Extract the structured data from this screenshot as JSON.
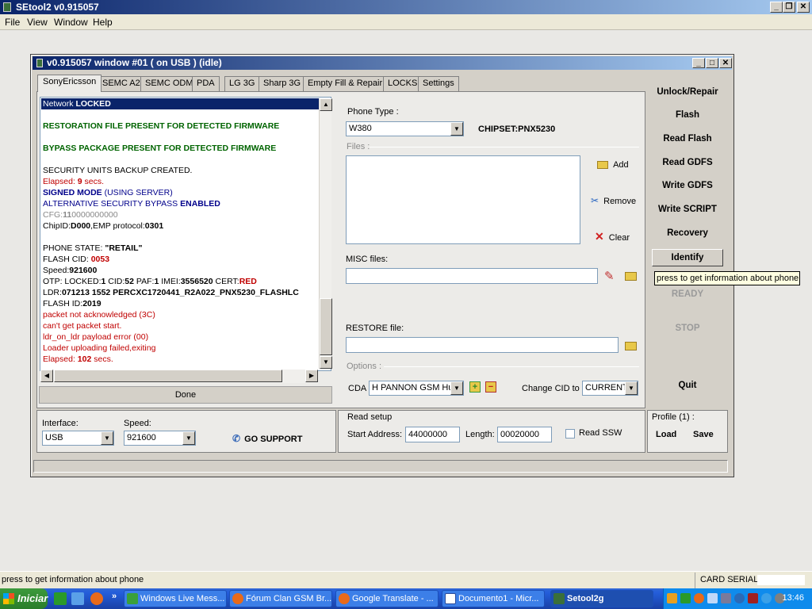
{
  "app": {
    "title": "SEtool2 v0.915057"
  },
  "menu": [
    "File",
    "View",
    "Window",
    "Help"
  ],
  "child": {
    "title": "v0.915057 window #01 ( on USB ) (idle)"
  },
  "tabs": [
    "SonyEricsson",
    "SEMC A2",
    "SEMC ODM",
    "PDA",
    "LG 3G",
    "Sharp 3G",
    "Empty Fill & Repair",
    "LOCKS",
    "Settings"
  ],
  "log": [
    {
      "parts": [
        {
          "t": "Network ",
          "c": ""
        },
        {
          "t": "LOCKED",
          "c": "b"
        }
      ],
      "selected": true
    },
    {
      "parts": []
    },
    {
      "parts": [
        {
          "t": "RESTORATION FILE PRESENT FOR DETECTED FIRMWARE",
          "c": "green b"
        }
      ]
    },
    {
      "parts": []
    },
    {
      "parts": [
        {
          "t": "BYPASS PACKAGE PRESENT FOR DETECTED FIRMWARE",
          "c": "green b"
        }
      ]
    },
    {
      "parts": []
    },
    {
      "parts": [
        {
          "t": "SECURITY UNITS BACKUP CREATED.",
          "c": ""
        }
      ]
    },
    {
      "parts": [
        {
          "t": "Elapsed: ",
          "c": "red"
        },
        {
          "t": "9",
          "c": "red b"
        },
        {
          "t": " secs.",
          "c": "red"
        }
      ]
    },
    {
      "parts": [
        {
          "t": "SIGNED MODE",
          "c": "blue b"
        },
        {
          "t": " (USING SERVER)",
          "c": "blue"
        }
      ]
    },
    {
      "parts": [
        {
          "t": "ALTERNATIVE SECURITY BYPASS ",
          "c": "blue"
        },
        {
          "t": "ENABLED",
          "c": "blue b"
        }
      ]
    },
    {
      "parts": [
        {
          "t": "CFG:",
          "c": "gray"
        },
        {
          "t": "11",
          "c": "gray b"
        },
        {
          "t": "0000000000",
          "c": "gray"
        }
      ]
    },
    {
      "parts": [
        {
          "t": "ChipID:",
          "c": ""
        },
        {
          "t": "D000",
          "c": "b"
        },
        {
          "t": ",EMP protocol:",
          "c": ""
        },
        {
          "t": "0301",
          "c": "b"
        }
      ]
    },
    {
      "parts": []
    },
    {
      "parts": [
        {
          "t": "PHONE STATE: ",
          "c": ""
        },
        {
          "t": "\"RETAIL\"",
          "c": "b"
        }
      ]
    },
    {
      "parts": [
        {
          "t": "FLASH CID: ",
          "c": ""
        },
        {
          "t": "0053",
          "c": "red b"
        }
      ]
    },
    {
      "parts": [
        {
          "t": "Speed:",
          "c": ""
        },
        {
          "t": "921600",
          "c": "b"
        }
      ]
    },
    {
      "parts": [
        {
          "t": "OTP: LOCKED:",
          "c": ""
        },
        {
          "t": "1",
          "c": "b"
        },
        {
          "t": " CID:",
          "c": ""
        },
        {
          "t": "52",
          "c": "b"
        },
        {
          "t": " PAF:",
          "c": ""
        },
        {
          "t": "1",
          "c": "b"
        },
        {
          "t": " IMEI:",
          "c": ""
        },
        {
          "t": "3556520",
          "c": "b"
        },
        {
          "t": "              CERT:",
          "c": ""
        },
        {
          "t": "RED",
          "c": "red b"
        }
      ]
    },
    {
      "parts": [
        {
          "t": "LDR:",
          "c": ""
        },
        {
          "t": "071213 1552 PERCXC1720441_R2A022_PNX5230_FLASHLC",
          "c": "b"
        }
      ]
    },
    {
      "parts": [
        {
          "t": "FLASH ID:",
          "c": ""
        },
        {
          "t": "2019",
          "c": "b"
        }
      ]
    },
    {
      "parts": [
        {
          "t": "packet not acknowledged (3C)",
          "c": "red"
        }
      ]
    },
    {
      "parts": [
        {
          "t": "can't get packet start.",
          "c": "red"
        }
      ]
    },
    {
      "parts": [
        {
          "t": "ldr_on_ldr payload error (00)",
          "c": "red"
        }
      ]
    },
    {
      "parts": [
        {
          "t": "Loader uploading failed,exiting",
          "c": "red"
        }
      ]
    },
    {
      "parts": [
        {
          "t": "Elapsed: ",
          "c": "red"
        },
        {
          "t": "102",
          "c": "red b"
        },
        {
          "t": " secs.",
          "c": "red"
        }
      ]
    }
  ],
  "done_label": "Done",
  "phone": {
    "type_label": "Phone Type :",
    "type_value": "W380",
    "chipset": "CHIPSET:PNX5230",
    "files_label": "Files :",
    "add": "Add",
    "remove": "Remove",
    "clear": "Clear",
    "misc_label": "MISC files:",
    "restore_label": "RESTORE file:",
    "options_label": "Options :",
    "cda_label": "CDA",
    "cda_value": "H PANNON GSM Hun",
    "change_cid_label": "Change CID to",
    "change_cid_value": "CURRENT"
  },
  "side_buttons": [
    "Unlock/Repair",
    "Flash",
    "Read Flash",
    "Read GDFS",
    "Write GDFS",
    "Write SCRIPT",
    "Recovery",
    "Identify"
  ],
  "status_buttons": {
    "ready": "READY",
    "stop": "STOP",
    "quit": "Quit"
  },
  "tooltip": "press to get information about phone",
  "interface": {
    "label": "Interface:",
    "value": "USB",
    "speed_label": "Speed:",
    "speed_value": "921600",
    "support": "GO SUPPORT"
  },
  "read_setup": {
    "label": "Read setup",
    "start_label": "Start Address:",
    "start_value": "44000000",
    "length_label": "Length:",
    "length_value": "00020000",
    "ssw_label": "Read SSW"
  },
  "profile": {
    "label": "Profile (1) :",
    "load": "Load",
    "save": "Save"
  },
  "statusbar": {
    "text": "press to get information about phone",
    "card_serial": "CARD SERIAL:"
  },
  "taskbar": {
    "start": "Iniciar",
    "buttons": [
      "Windows Live Mess...",
      "Fórum Clan GSM Br...",
      "Google Translate - ...",
      "Documento1 - Micr...",
      "Setool2g"
    ],
    "clock": "13:46"
  },
  "colors": {
    "titlebar": "#0a246a",
    "log_green": "#006400",
    "log_red": "#c00000",
    "log_blue": "#00008b"
  }
}
